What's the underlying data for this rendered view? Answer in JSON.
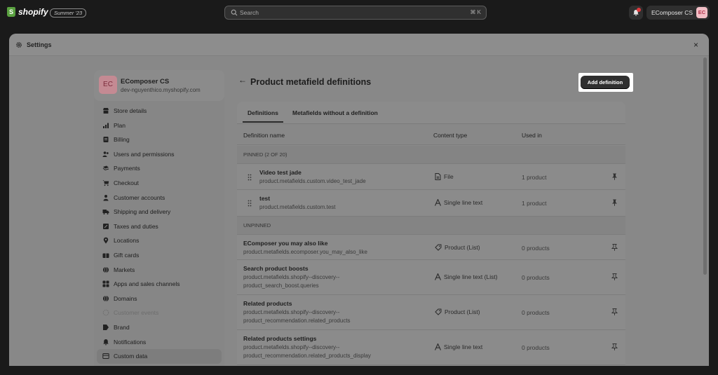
{
  "topbar": {
    "logo_text": "shopify",
    "edition_badge": "Summer '23",
    "search_placeholder": "Search",
    "search_shortcut": "⌘ K",
    "store_name": "EComposer CS",
    "store_initials": "EC"
  },
  "modal": {
    "title": "Settings",
    "close_glyph": "×"
  },
  "sidebar": {
    "store_initials": "EC",
    "store_name": "EComposer CS",
    "store_domain": "dev-nguyenthico.myshopify.com",
    "items": [
      {
        "label": "Store details",
        "icon": "store-icon"
      },
      {
        "label": "Plan",
        "icon": "plan-icon"
      },
      {
        "label": "Billing",
        "icon": "billing-icon"
      },
      {
        "label": "Users and permissions",
        "icon": "users-icon"
      },
      {
        "label": "Payments",
        "icon": "payments-icon"
      },
      {
        "label": "Checkout",
        "icon": "cart-icon"
      },
      {
        "label": "Customer accounts",
        "icon": "customer-icon"
      },
      {
        "label": "Shipping and delivery",
        "icon": "truck-icon"
      },
      {
        "label": "Taxes and duties",
        "icon": "tax-icon"
      },
      {
        "label": "Locations",
        "icon": "location-icon"
      },
      {
        "label": "Gift cards",
        "icon": "gift-icon"
      },
      {
        "label": "Markets",
        "icon": "globe-icon"
      },
      {
        "label": "Apps and sales channels",
        "icon": "apps-icon"
      },
      {
        "label": "Domains",
        "icon": "globe-icon"
      },
      {
        "label": "Customer events",
        "icon": "events-icon"
      },
      {
        "label": "Brand",
        "icon": "brand-icon"
      },
      {
        "label": "Notifications",
        "icon": "bell-icon"
      },
      {
        "label": "Custom data",
        "icon": "database-icon"
      }
    ]
  },
  "page": {
    "back_glyph": "←",
    "title": "Product metafield definitions",
    "add_button": "Add definition"
  },
  "tabs": [
    "Definitions",
    "Metafields without a definition"
  ],
  "columns": {
    "name": "Definition name",
    "content_type": "Content type",
    "used_in": "Used in"
  },
  "pinned_header": "PINNED (2 OF 20)",
  "unpinned_header": "UNPINNED",
  "pinned_rows": [
    {
      "name": "Video test jade",
      "key": "product.metafields.custom.video_test_jade",
      "type": "File",
      "type_icon": "file-icon",
      "used": "1 product"
    },
    {
      "name": "test",
      "key": "product.metafields.custom.test",
      "type": "Single line text",
      "type_icon": "text-icon",
      "used": "1 product"
    }
  ],
  "unpinned_rows": [
    {
      "name": "EComposer you may also like",
      "key": "product.metafields.ecomposer.you_may_also_like",
      "type": "Product (List)",
      "type_icon": "product-tag-icon",
      "used": "0 products"
    },
    {
      "name": "Search product boosts",
      "key": "product.metafields.shopify--discovery--product_search_boost.queries",
      "type": "Single line text (List)",
      "type_icon": "text-icon",
      "used": "0 products"
    },
    {
      "name": "Related products",
      "key": "product.metafields.shopify--discovery--product_recommendation.related_products",
      "type": "Product (List)",
      "type_icon": "product-tag-icon",
      "used": "0 products"
    },
    {
      "name": "Related products settings",
      "key": "product.metafields.shopify--discovery--product_recommendation.related_products_display",
      "type": "Single line text",
      "type_icon": "text-icon",
      "used": "0 products"
    }
  ]
}
